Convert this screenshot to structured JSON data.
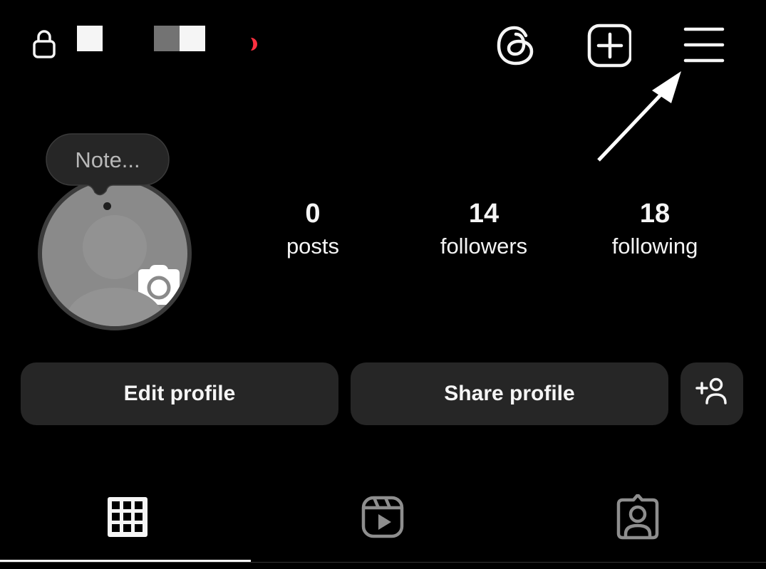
{
  "header": {
    "private_account": true,
    "username_redacted": true,
    "has_live_indicator": true,
    "icons": {
      "lock": "lock-icon",
      "threads": "threads-icon",
      "create": "plus-square-icon",
      "menu": "hamburger-menu-icon"
    }
  },
  "profile": {
    "note_placeholder": "Note...",
    "avatar": "default-avatar-with-camera",
    "stats": [
      {
        "count": "0",
        "label": "posts"
      },
      {
        "count": "14",
        "label": "followers"
      },
      {
        "count": "18",
        "label": "following"
      }
    ]
  },
  "actions": {
    "edit_profile": "Edit profile",
    "share_profile": "Share profile",
    "discover_people_icon": "add-person-icon"
  },
  "tabs": [
    {
      "name": "posts",
      "icon": "grid-icon",
      "active": true
    },
    {
      "name": "reels",
      "icon": "reels-icon",
      "active": false
    },
    {
      "name": "tagged",
      "icon": "tagged-person-icon",
      "active": false
    }
  ],
  "annotation": {
    "type": "arrow",
    "points_to": "menu"
  },
  "colors": {
    "background": "#000000",
    "text": "#f5f5f5",
    "button_bg": "#262626",
    "inactive_icon": "#8e8e8e",
    "live_red": "#ff3040",
    "note_bg": "#262626",
    "note_text": "#b8b8b8"
  }
}
